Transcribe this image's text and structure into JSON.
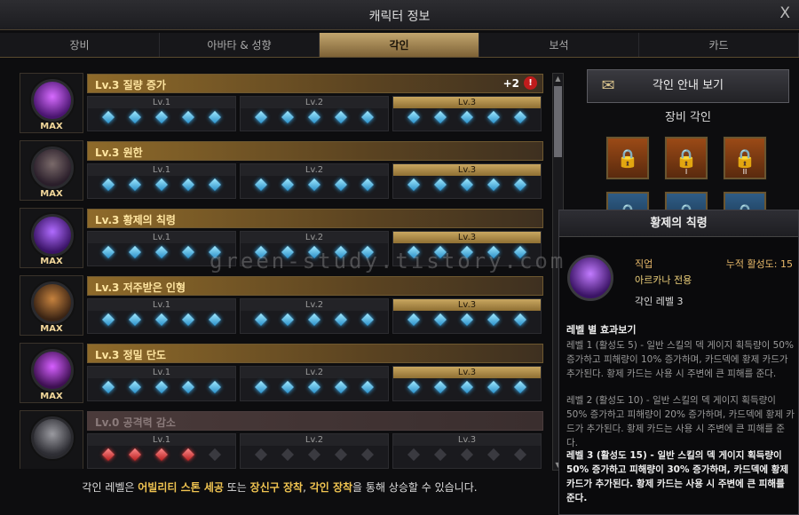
{
  "window": {
    "title": "캐릭터 정보",
    "close": "X"
  },
  "tabs": [
    {
      "label": "장비"
    },
    {
      "label": "아바타 & 성향"
    },
    {
      "label": "각인"
    },
    {
      "label": "보석"
    },
    {
      "label": "카드"
    }
  ],
  "engravings": [
    {
      "name": "Lv.3 질량 증가",
      "max": "MAX",
      "bonus": "+2",
      "alert": "!",
      "levels": [
        "Lv.1",
        "Lv.2",
        "Lv.3"
      ]
    },
    {
      "name": "Lv.3 원한",
      "max": "MAX",
      "levels": [
        "Lv.1",
        "Lv.2",
        "Lv.3"
      ]
    },
    {
      "name": "Lv.3 황제의 칙령",
      "max": "MAX",
      "levels": [
        "Lv.1",
        "Lv.2",
        "Lv.3"
      ]
    },
    {
      "name": "Lv.3 저주받은 인형",
      "max": "MAX",
      "levels": [
        "Lv.1",
        "Lv.2",
        "Lv.3"
      ]
    },
    {
      "name": "Lv.3 정밀 단도",
      "max": "MAX",
      "levels": [
        "Lv.1",
        "Lv.2",
        "Lv.3"
      ]
    },
    {
      "name": "Lv.0 공격력 감소",
      "levels": [
        "Lv.1",
        "Lv.2",
        "Lv.3"
      ]
    }
  ],
  "side": {
    "guide_label": "각인 안내 보기",
    "equip_title": "장비 각인",
    "slots": [
      {
        "rank": ""
      },
      {
        "rank": "I"
      },
      {
        "rank": "II"
      },
      {
        "rank": ""
      },
      {
        "rank": ""
      },
      {
        "rank": ""
      }
    ]
  },
  "tooltip": {
    "title": "황제의 칙령",
    "job_label": "직업",
    "activity": "누적 활성도: 15",
    "class_name": "아르카나 전용",
    "level": "각인 레벨 3",
    "section": "레벨 별 효과보기",
    "lines": [
      "레벨 1 (활성도 5) - 일반 스킬의 덱 게이지 획득량이 50% 증가하고 피해량이 10% 증가하며, 카드덱에 황제 카드가 추가된다. 황제 카드는 사용 시 주변에 큰 피해를 준다.",
      "레벨 2 (활성도 10) - 일반 스킬의 덱 게이지 획득량이 50% 증가하고 피해량이 20% 증가하며, 카드덱에 황제 카드가 추가된다. 황제 카드는 사용 시 주변에 큰 피해를 준다.",
      "레벨 3 (활성도 15) - 일반 스킬의 덱 게이지 획득량이 50% 증가하고 피해량이 30% 증가하며, 카드덱에 황제 카드가 추가된다. 황제 카드는 사용 시 주변에 큰 피해를 준다."
    ]
  },
  "footer": {
    "pre": "각인 레벨은 ",
    "h1": "어빌리티 스톤 세공",
    "m1": " 또는 ",
    "h2": "장신구 장착",
    "m2": ", ",
    "h3": "각인 장착",
    "post": "을 통해 상승할 수 있습니다."
  },
  "watermark": "green-study.tistory.com"
}
